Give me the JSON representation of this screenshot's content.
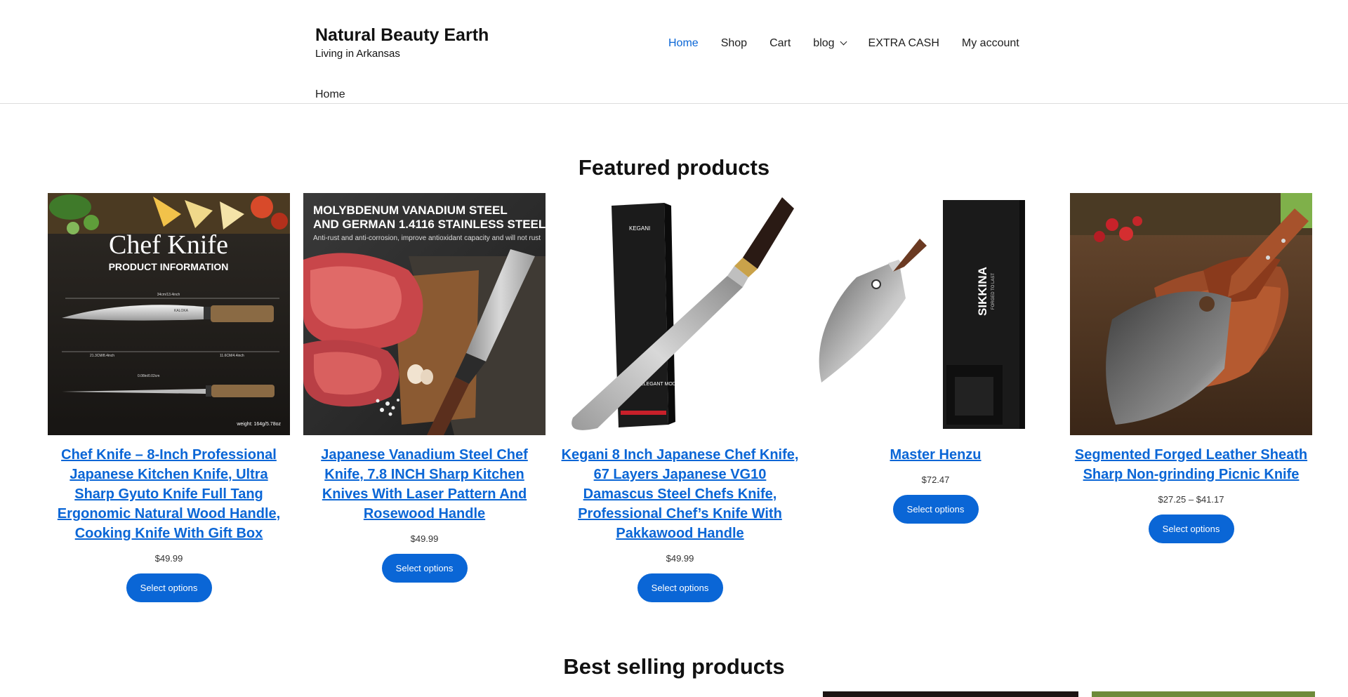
{
  "site": {
    "title": "Natural Beauty Earth",
    "tagline": "Living in Arkansas"
  },
  "nav": {
    "items": [
      {
        "label": "Home",
        "active": true
      },
      {
        "label": "Shop"
      },
      {
        "label": "Cart"
      },
      {
        "label": "blog",
        "has_dropdown": true
      },
      {
        "label": "EXTRA CASH"
      },
      {
        "label": "My account"
      }
    ]
  },
  "breadcrumb": "Home",
  "featured": {
    "title": "Featured products",
    "products": [
      {
        "name": "Chef Knife – 8-Inch Professional Japanese Kitchen Knife, Ultra Sharp Gyuto Knife Full Tang Ergonomic Natural Wood Handle, Cooking Knife With Gift Box",
        "price": "$49.99",
        "button": "Select options",
        "image": {
          "headline": "Chef Knife",
          "subheadline": "PRODUCT INFORMATION",
          "brand": "KALOKA",
          "dim_total": "34cm/13.4inch",
          "dim_blade": "21.3CM/8.4inch",
          "dim_handle": "11.6CM/4.4inch",
          "dim_thickness": "0.08in/0.02cm",
          "weight": "weight: 164g/5.78oz"
        }
      },
      {
        "name": "Japanese Vanadium Steel Chef Knife, 7.8 INCH Sharp Kitchen Knives With Laser Pattern And Rosewood Handle",
        "price": "$49.99",
        "button": "Select options",
        "image": {
          "headline_1": "MOLYBDENUM VANADIUM STEEL",
          "headline_2": "AND GERMAN 1.4116 STAINLESS STEEL",
          "caption": "Anti-rust and anti-corrosion, improve antioxidant capacity and will not rust"
        }
      },
      {
        "name": "Kegani 8 Inch Japanese Chef Knife, 67 Layers Japanese VG10 Damascus Steel Chefs Knife, Professional Chef’s Knife With Pakkawood Handle",
        "price": "$49.99",
        "button": "Select options",
        "image": {
          "box_brand": "KEGANI",
          "box_text": "ELEGANT MODERN"
        }
      },
      {
        "name": "Master Henzu",
        "price": "$72.47",
        "button": "Select options",
        "image": {
          "box_brand": "SIKKINA",
          "box_sub": "FORGED TO LAST"
        }
      },
      {
        "name": "Segmented Forged Leather Sheath Sharp Non-grinding Picnic Knife",
        "price": "$27.25 – $41.17",
        "button": "Select options"
      }
    ]
  },
  "best_selling": {
    "title": "Best selling products"
  },
  "colors": {
    "accent": "#0a66d6",
    "text": "#1e1e1e",
    "rule": "#dddddd"
  }
}
